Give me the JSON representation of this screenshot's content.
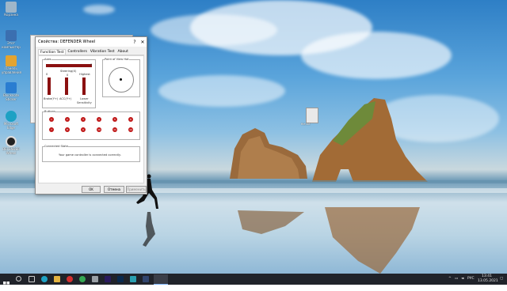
{
  "desktop": {
    "icons": [
      {
        "label": "Корзина",
        "color": "#9fb6c9"
      },
      {
        "label": "Этот компьютер",
        "color": "#3b6fb0"
      },
      {
        "label": "Панель управления",
        "color": "#e3a431"
      },
      {
        "label": "Blocknote Sticker",
        "color": "#2a7dd1"
      },
      {
        "label": "Microsoft Edge",
        "color": "#1da1c4"
      },
      {
        "label": "DEFENDER Wheel",
        "color": "#222222"
      }
    ],
    "file_icon_label": "file.txt"
  },
  "dialog": {
    "title": "Свойства: DEFENDER Wheel",
    "title_buttons": [
      "?",
      "✕"
    ],
    "tabs": [
      "Function Test",
      "Controllers",
      "Vibration Test",
      "About"
    ],
    "active_tab": 0,
    "axes_label": "Axes",
    "steering_label": "Steering(X)",
    "steering_left": "0",
    "steering_right": "0",
    "axis_values": [
      "0",
      "0",
      "0"
    ],
    "brake_label": "Brake(Y+)",
    "acc_label": "ACC(Y+)",
    "highest_label": "Highest",
    "lower_label": "Lower",
    "sensitivity_label": "Sensitivity",
    "pov_label": "Point of View Hat",
    "buttons_label": "Buttons",
    "button_numbers": [
      "1",
      "2",
      "3",
      "4",
      "5",
      "6",
      "7",
      "8",
      "9",
      "10",
      "11",
      "12"
    ],
    "connected_label": "Connected State",
    "connected_text": "Your game controller is connected correctly.",
    "ok_label": "OK",
    "cancel_label": "Отмена",
    "apply_label": "Применить"
  },
  "taskbar": {
    "tray_lang": "РУС",
    "time": "13:41",
    "date": "13.05.2021"
  },
  "colors": {
    "taskbar": "#20232a",
    "accent_red": "#c01818"
  }
}
